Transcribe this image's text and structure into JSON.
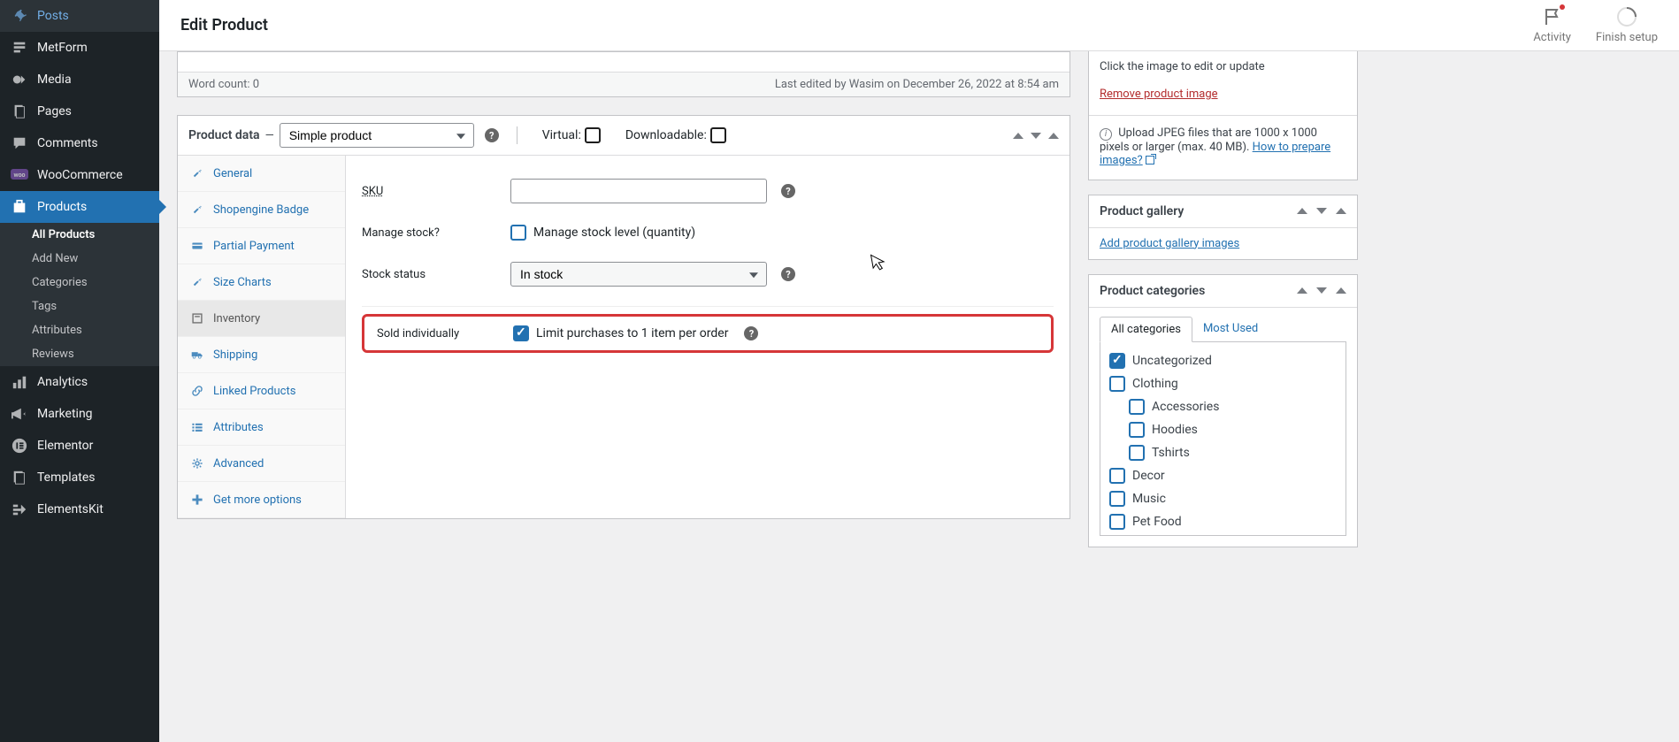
{
  "topbar": {
    "title": "Edit Product",
    "activity": "Activity",
    "finish_setup": "Finish setup"
  },
  "sidebar": {
    "items": [
      {
        "label": "Posts"
      },
      {
        "label": "MetForm"
      },
      {
        "label": "Media"
      },
      {
        "label": "Pages"
      },
      {
        "label": "Comments"
      },
      {
        "label": "WooCommerce"
      },
      {
        "label": "Products",
        "current": true
      },
      {
        "label": "Analytics"
      },
      {
        "label": "Marketing"
      },
      {
        "label": "Elementor"
      },
      {
        "label": "Templates"
      },
      {
        "label": "ElementsKit"
      }
    ],
    "submenu": [
      {
        "label": "All Products",
        "current": true
      },
      {
        "label": "Add New"
      },
      {
        "label": "Categories"
      },
      {
        "label": "Tags"
      },
      {
        "label": "Attributes"
      },
      {
        "label": "Reviews"
      }
    ]
  },
  "editor": {
    "word_count": "Word count: 0",
    "last_edited": "Last edited by Wasim on December 26, 2022 at 8:54 am"
  },
  "product_data": {
    "heading": "Product data",
    "type_selected": "Simple product",
    "virtual_label": "Virtual:",
    "downloadable_label": "Downloadable:",
    "tabs": [
      {
        "label": "General"
      },
      {
        "label": "Shopengine Badge"
      },
      {
        "label": "Partial Payment"
      },
      {
        "label": "Size Charts"
      },
      {
        "label": "Inventory",
        "active": true
      },
      {
        "label": "Shipping"
      },
      {
        "label": "Linked Products"
      },
      {
        "label": "Attributes"
      },
      {
        "label": "Advanced"
      },
      {
        "label": "Get more options"
      }
    ],
    "inventory": {
      "sku_label": "SKU",
      "sku_value": "",
      "manage_stock_label": "Manage stock?",
      "manage_stock_text": "Manage stock level (quantity)",
      "stock_status_label": "Stock status",
      "stock_status_value": "In stock",
      "sold_individually_label": "Sold individually",
      "sold_individually_text": "Limit purchases to 1 item per order"
    }
  },
  "product_image": {
    "edit_text": "Click the image to edit or update",
    "remove_link": "Remove product image",
    "upload_note": "Upload JPEG files that are 1000 x 1000 pixels or larger (max. 40 MB). ",
    "prepare_link": "How to prepare images?"
  },
  "product_gallery": {
    "heading": "Product gallery",
    "add_link": "Add product gallery images"
  },
  "product_categories": {
    "heading": "Product categories",
    "tab_all": "All categories",
    "tab_most": "Most Used",
    "items": [
      {
        "label": "Uncategorized",
        "checked": true,
        "nested": false
      },
      {
        "label": "Clothing",
        "checked": false,
        "nested": false
      },
      {
        "label": "Accessories",
        "checked": false,
        "nested": true
      },
      {
        "label": "Hoodies",
        "checked": false,
        "nested": true
      },
      {
        "label": "Tshirts",
        "checked": false,
        "nested": true
      },
      {
        "label": "Decor",
        "checked": false,
        "nested": false
      },
      {
        "label": "Music",
        "checked": false,
        "nested": false
      },
      {
        "label": "Pet Food",
        "checked": false,
        "nested": false
      }
    ]
  }
}
